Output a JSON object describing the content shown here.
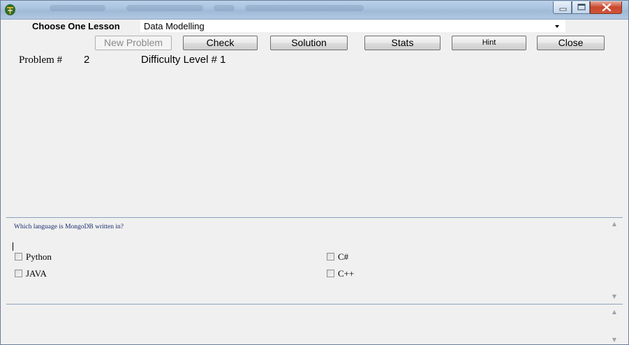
{
  "window": {
    "title_icon": "app-logo-icon",
    "controls": {
      "minimize": "minimize-icon",
      "maximize": "maximize-icon",
      "close": "close-icon"
    },
    "close_color": "#c7472d"
  },
  "lesson": {
    "label": "Choose One Lesson",
    "selected": "Data Modelling"
  },
  "toolbar": {
    "new_problem": "New Problem",
    "check": "Check",
    "solution": "Solution",
    "stats": "Stats",
    "hint": "Hint",
    "close": "Close"
  },
  "problem": {
    "label": "Problem #",
    "number": "2",
    "difficulty": "Difficulty Level # 1"
  },
  "question": {
    "text": "Which language is MongoDB written in?",
    "options": [
      {
        "label": "Python",
        "checked": false
      },
      {
        "label": "C#",
        "checked": false
      },
      {
        "label": "JAVA",
        "checked": false
      },
      {
        "label": "C++",
        "checked": false
      }
    ]
  }
}
